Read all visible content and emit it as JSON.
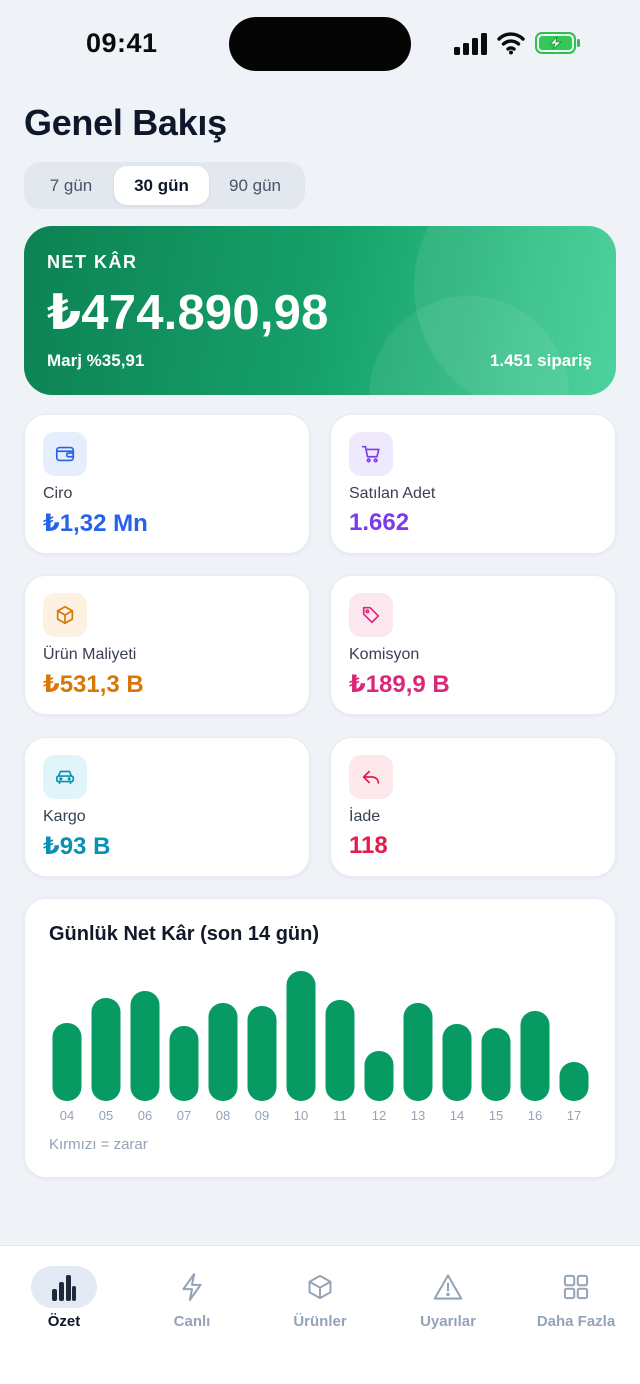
{
  "status_bar": {
    "time": "09:41"
  },
  "page_title": "Genel Bakış",
  "period_tabs": [
    {
      "label": "7 gün",
      "selected": false
    },
    {
      "label": "30 gün",
      "selected": true
    },
    {
      "label": "90 gün",
      "selected": false
    }
  ],
  "hero": {
    "label": "NET KÂR",
    "value": "₺474.890,98",
    "margin": "Marj %35,91",
    "orders": "1.451 sipariş"
  },
  "metrics": [
    {
      "label": "Ciro",
      "value": "₺1,32 Mn",
      "icon": "wallet-icon",
      "color": "#2563eb",
      "bg": "#e6edfd"
    },
    {
      "label": "Satılan Adet",
      "value": "1.662",
      "icon": "cart-icon",
      "color": "#7c3aed",
      "bg": "#efe9fd"
    },
    {
      "label": "Ürün Maliyeti",
      "value": "₺531,3 B",
      "icon": "box-icon",
      "color": "#d97706",
      "bg": "#fdf1e1"
    },
    {
      "label": "Komisyon",
      "value": "₺189,9 B",
      "icon": "tag-icon",
      "color": "#db2777",
      "bg": "#fce7f1"
    },
    {
      "label": "Kargo",
      "value": "₺93 B",
      "icon": "truck-icon",
      "color": "#0891b2",
      "bg": "#e0f4fa"
    },
    {
      "label": "İade",
      "value": "118",
      "icon": "return-icon",
      "color": "#e11d48",
      "bg": "#fde8ec"
    }
  ],
  "chart": {
    "title": "Günlük Net Kâr (son 14 gün)",
    "note": "Kırmızı = zarar"
  },
  "chart_data": {
    "type": "bar",
    "categories": [
      "04",
      "05",
      "06",
      "07",
      "08",
      "09",
      "10",
      "11",
      "12",
      "13",
      "14",
      "15",
      "16",
      "17"
    ],
    "values": [
      78,
      103,
      110,
      75,
      98,
      95,
      130,
      101,
      50,
      98,
      77,
      73,
      90,
      39
    ],
    "color": "#079a63",
    "loss_color": "#e11d48"
  },
  "tabs": [
    {
      "label": "Özet",
      "icon": "chart-bars-icon",
      "active": true
    },
    {
      "label": "Canlı",
      "icon": "lightning-icon",
      "active": false
    },
    {
      "label": "Ürünler",
      "icon": "cube-icon",
      "active": false
    },
    {
      "label": "Uyarılar",
      "icon": "warning-icon",
      "active": false
    },
    {
      "label": "Daha Fazla",
      "icon": "grid-icon",
      "active": false
    }
  ]
}
